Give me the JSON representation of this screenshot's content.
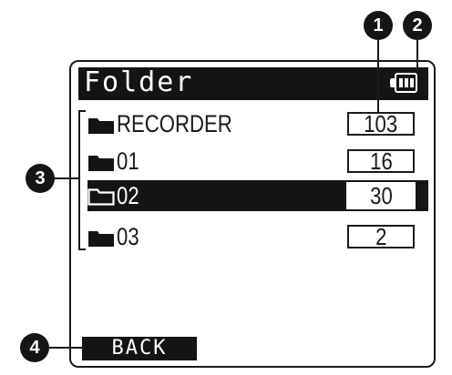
{
  "screen": {
    "title": "Folder",
    "battery_icon": "battery-icon",
    "rows": [
      {
        "name": "RECORDER",
        "count": "103",
        "selected": false
      },
      {
        "name": "01",
        "count": "16",
        "selected": false
      },
      {
        "name": "02",
        "count": "30",
        "selected": true
      },
      {
        "name": "03",
        "count": "2",
        "selected": false
      }
    ],
    "back_label": "BACK"
  },
  "callouts": [
    "1",
    "2",
    "3",
    "4"
  ],
  "colors": {
    "ink": "#141414",
    "paper": "#ffffff"
  }
}
